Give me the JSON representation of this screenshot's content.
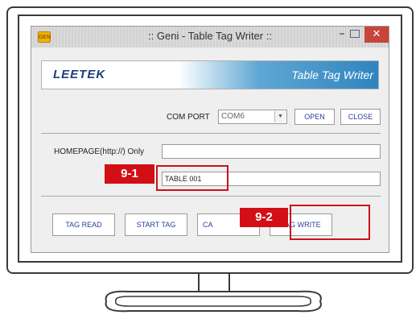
{
  "window": {
    "title": ":: Geni - Table Tag Writer ::",
    "app_icon_text": "GEN",
    "minimize_glyph": "–",
    "close_glyph": "✕"
  },
  "banner": {
    "logo": "LEETEK",
    "title": "Table Tag Writer"
  },
  "com_port": {
    "label": "COM PORT",
    "value": "COM6",
    "open_label": "OPEN",
    "close_label": "CLOSE"
  },
  "homepage": {
    "label": "HOMEPAGE(http://) Only",
    "value": ""
  },
  "table_name": {
    "value": "TABLE 001"
  },
  "buttons": {
    "tag_read": "TAG READ",
    "start_tag": "START TAG",
    "cancel_partial": "CA",
    "tag_write": "TAG WRITE"
  },
  "annotations": {
    "step_1": "9-1",
    "step_2": "9-2",
    "highlight_color": "#d30e15"
  }
}
